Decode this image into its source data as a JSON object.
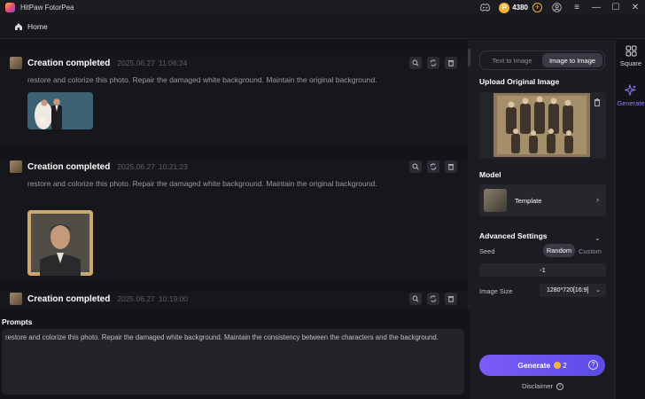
{
  "app": {
    "title": "HitPaw FotorPea"
  },
  "titlebar": {
    "coins": "4380",
    "coin_symbol": "P",
    "coin_add": "+",
    "minimize": "—",
    "maximize": "☐",
    "close": "✕",
    "menu": "≡"
  },
  "nav": {
    "home": "Home"
  },
  "feed": {
    "cards": [
      {
        "title": "Creation completed",
        "date": "2025.06.27",
        "time": "11:06:24",
        "prompt": "restore and colorize this photo. Repair the damaged white background. Maintain the original background."
      },
      {
        "title": "Creation completed",
        "date": "2025.06.27",
        "time": "10:21:23",
        "prompt": "restore and colorize this photo. Repair the damaged white background. Maintain the original background."
      },
      {
        "title": "Creation completed",
        "date": "2025.06.27",
        "time": "10:19:00"
      }
    ]
  },
  "prompts": {
    "title": "Prompts",
    "text": "restore and colorize this photo. Repair the damaged white background. Maintain the consistency between the characters and the background."
  },
  "panel": {
    "tabs": [
      "Text to Image",
      "Image to Image"
    ],
    "active_tab": "Image to Image",
    "upload_label": "Upload Original Image",
    "model_label": "Model",
    "model_name": "Template",
    "advanced_label": "Advanced Settings",
    "seed_label": "Seed",
    "seed_random": "Random",
    "seed_custom": "Custom",
    "seed_value": "-1",
    "size_label": "Image Size",
    "size_value": "1280*720[16:9]",
    "generate_label": "Generate",
    "generate_cost": "2",
    "generate_help": "?",
    "disclaimer": "Disclaimer",
    "disclaimer_icon": "i"
  },
  "side": {
    "square": "Square",
    "generate": "Generate"
  },
  "colors": {
    "accent": "#7b5cf5",
    "coin": "#f2b33a",
    "bg": "#131318",
    "panel": "#1b1b21"
  }
}
